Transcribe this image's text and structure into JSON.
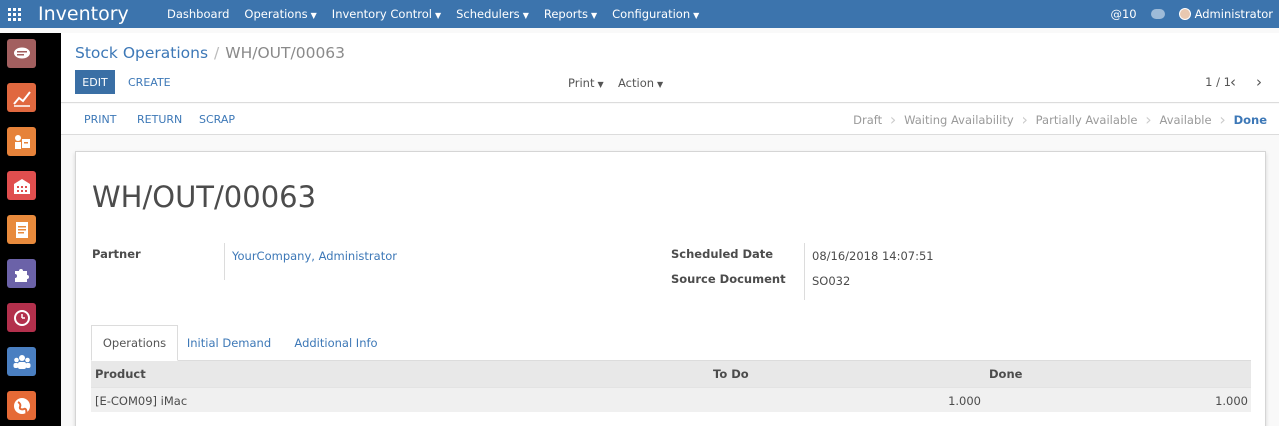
{
  "topbar": {
    "app_title": "Inventory",
    "menu": [
      "Dashboard",
      "Operations",
      "Inventory Control",
      "Schedulers",
      "Reports",
      "Configuration"
    ],
    "mentions": "@10",
    "user": "Administrator",
    "color": "#3c74ad"
  },
  "sidebar": {
    "apps": [
      {
        "icon": "discuss-icon",
        "color": "#a25f5f"
      },
      {
        "icon": "sales-chart-icon",
        "color": "#e0683f"
      },
      {
        "icon": "crm-icon",
        "color": "#e6823a"
      },
      {
        "icon": "warehouse-icon",
        "color": "#e04e4e"
      },
      {
        "icon": "invoicing-icon",
        "color": "#e88a3c"
      },
      {
        "icon": "apps-puzzle-icon",
        "color": "#6b62a8"
      },
      {
        "icon": "clock-icon",
        "color": "#b3304c"
      },
      {
        "icon": "employees-icon",
        "color": "#4a7fc1"
      },
      {
        "icon": "globe-icon",
        "color": "#e56a36"
      }
    ]
  },
  "breadcrumb": {
    "parent": "Stock Operations",
    "separator": "/",
    "current": "WH/OUT/00063"
  },
  "buttons": {
    "edit": "EDIT",
    "create": "CREATE",
    "print_dropdown": "Print",
    "action_dropdown": "Action"
  },
  "pager": {
    "value": "1 / 1",
    "prev": "‹",
    "next": "›"
  },
  "statusbar": {
    "actions": [
      "PRINT",
      "RETURN",
      "SCRAP"
    ],
    "stages": [
      "Draft",
      "Waiting Availability",
      "Partially Available",
      "Available",
      "Done"
    ],
    "active_stage": "Done"
  },
  "record": {
    "title": "WH/OUT/00063",
    "partner_label": "Partner",
    "partner_value": "YourCompany, Administrator",
    "scheduled_date_label": "Scheduled Date",
    "scheduled_date_value": "08/16/2018 14:07:51",
    "source_document_label": "Source Document",
    "source_document_value": "SO032"
  },
  "tabs": [
    "Operations",
    "Initial Demand",
    "Additional Info"
  ],
  "operations_table": {
    "columns": [
      "Product",
      "To Do",
      "Done"
    ],
    "rows": [
      {
        "product": "[E-COM09] iMac",
        "todo": "1.000",
        "done": "1.000"
      }
    ]
  }
}
